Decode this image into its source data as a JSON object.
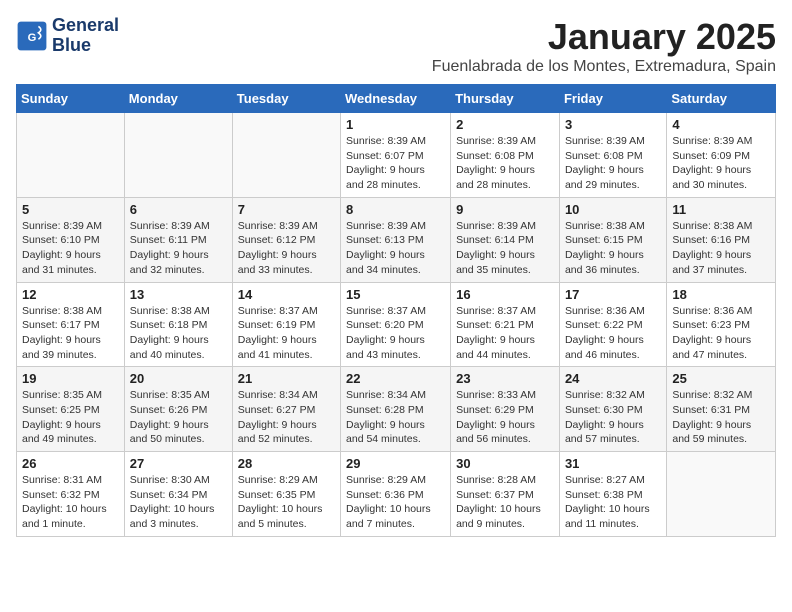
{
  "logo": {
    "line1": "General",
    "line2": "Blue"
  },
  "title": "January 2025",
  "location": "Fuenlabrada de los Montes, Extremadura, Spain",
  "headers": [
    "Sunday",
    "Monday",
    "Tuesday",
    "Wednesday",
    "Thursday",
    "Friday",
    "Saturday"
  ],
  "weeks": [
    [
      {
        "day": "",
        "info": ""
      },
      {
        "day": "",
        "info": ""
      },
      {
        "day": "",
        "info": ""
      },
      {
        "day": "1",
        "info": "Sunrise: 8:39 AM\nSunset: 6:07 PM\nDaylight: 9 hours\nand 28 minutes."
      },
      {
        "day": "2",
        "info": "Sunrise: 8:39 AM\nSunset: 6:08 PM\nDaylight: 9 hours\nand 28 minutes."
      },
      {
        "day": "3",
        "info": "Sunrise: 8:39 AM\nSunset: 6:08 PM\nDaylight: 9 hours\nand 29 minutes."
      },
      {
        "day": "4",
        "info": "Sunrise: 8:39 AM\nSunset: 6:09 PM\nDaylight: 9 hours\nand 30 minutes."
      }
    ],
    [
      {
        "day": "5",
        "info": "Sunrise: 8:39 AM\nSunset: 6:10 PM\nDaylight: 9 hours\nand 31 minutes."
      },
      {
        "day": "6",
        "info": "Sunrise: 8:39 AM\nSunset: 6:11 PM\nDaylight: 9 hours\nand 32 minutes."
      },
      {
        "day": "7",
        "info": "Sunrise: 8:39 AM\nSunset: 6:12 PM\nDaylight: 9 hours\nand 33 minutes."
      },
      {
        "day": "8",
        "info": "Sunrise: 8:39 AM\nSunset: 6:13 PM\nDaylight: 9 hours\nand 34 minutes."
      },
      {
        "day": "9",
        "info": "Sunrise: 8:39 AM\nSunset: 6:14 PM\nDaylight: 9 hours\nand 35 minutes."
      },
      {
        "day": "10",
        "info": "Sunrise: 8:38 AM\nSunset: 6:15 PM\nDaylight: 9 hours\nand 36 minutes."
      },
      {
        "day": "11",
        "info": "Sunrise: 8:38 AM\nSunset: 6:16 PM\nDaylight: 9 hours\nand 37 minutes."
      }
    ],
    [
      {
        "day": "12",
        "info": "Sunrise: 8:38 AM\nSunset: 6:17 PM\nDaylight: 9 hours\nand 39 minutes."
      },
      {
        "day": "13",
        "info": "Sunrise: 8:38 AM\nSunset: 6:18 PM\nDaylight: 9 hours\nand 40 minutes."
      },
      {
        "day": "14",
        "info": "Sunrise: 8:37 AM\nSunset: 6:19 PM\nDaylight: 9 hours\nand 41 minutes."
      },
      {
        "day": "15",
        "info": "Sunrise: 8:37 AM\nSunset: 6:20 PM\nDaylight: 9 hours\nand 43 minutes."
      },
      {
        "day": "16",
        "info": "Sunrise: 8:37 AM\nSunset: 6:21 PM\nDaylight: 9 hours\nand 44 minutes."
      },
      {
        "day": "17",
        "info": "Sunrise: 8:36 AM\nSunset: 6:22 PM\nDaylight: 9 hours\nand 46 minutes."
      },
      {
        "day": "18",
        "info": "Sunrise: 8:36 AM\nSunset: 6:23 PM\nDaylight: 9 hours\nand 47 minutes."
      }
    ],
    [
      {
        "day": "19",
        "info": "Sunrise: 8:35 AM\nSunset: 6:25 PM\nDaylight: 9 hours\nand 49 minutes."
      },
      {
        "day": "20",
        "info": "Sunrise: 8:35 AM\nSunset: 6:26 PM\nDaylight: 9 hours\nand 50 minutes."
      },
      {
        "day": "21",
        "info": "Sunrise: 8:34 AM\nSunset: 6:27 PM\nDaylight: 9 hours\nand 52 minutes."
      },
      {
        "day": "22",
        "info": "Sunrise: 8:34 AM\nSunset: 6:28 PM\nDaylight: 9 hours\nand 54 minutes."
      },
      {
        "day": "23",
        "info": "Sunrise: 8:33 AM\nSunset: 6:29 PM\nDaylight: 9 hours\nand 56 minutes."
      },
      {
        "day": "24",
        "info": "Sunrise: 8:32 AM\nSunset: 6:30 PM\nDaylight: 9 hours\nand 57 minutes."
      },
      {
        "day": "25",
        "info": "Sunrise: 8:32 AM\nSunset: 6:31 PM\nDaylight: 9 hours\nand 59 minutes."
      }
    ],
    [
      {
        "day": "26",
        "info": "Sunrise: 8:31 AM\nSunset: 6:32 PM\nDaylight: 10 hours\nand 1 minute."
      },
      {
        "day": "27",
        "info": "Sunrise: 8:30 AM\nSunset: 6:34 PM\nDaylight: 10 hours\nand 3 minutes."
      },
      {
        "day": "28",
        "info": "Sunrise: 8:29 AM\nSunset: 6:35 PM\nDaylight: 10 hours\nand 5 minutes."
      },
      {
        "day": "29",
        "info": "Sunrise: 8:29 AM\nSunset: 6:36 PM\nDaylight: 10 hours\nand 7 minutes."
      },
      {
        "day": "30",
        "info": "Sunrise: 8:28 AM\nSunset: 6:37 PM\nDaylight: 10 hours\nand 9 minutes."
      },
      {
        "day": "31",
        "info": "Sunrise: 8:27 AM\nSunset: 6:38 PM\nDaylight: 10 hours\nand 11 minutes."
      },
      {
        "day": "",
        "info": ""
      }
    ]
  ]
}
